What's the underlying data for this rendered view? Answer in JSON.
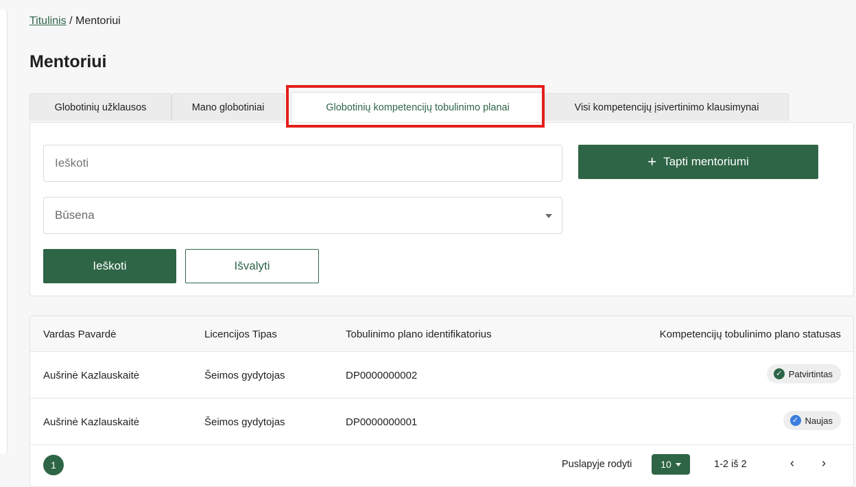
{
  "breadcrumb": {
    "home": "Titulinis",
    "separator": " / ",
    "current": "Mentoriui"
  },
  "page": {
    "title": "Mentoriui"
  },
  "tabs": [
    {
      "label": "Globotinių užklausos"
    },
    {
      "label": "Mano globotiniai"
    },
    {
      "label": "Globotinių kompetencijų tobulinimo planai",
      "active": true
    },
    {
      "label": "Visi kompetencijų įsivertinimo klausimynai"
    }
  ],
  "filters": {
    "search_placeholder": "Ieškoti",
    "status_placeholder": "Būsena",
    "become_mentor_label": "Tapti mentoriumi",
    "search_button": "Ieškoti",
    "clear_button": "Išvalyti"
  },
  "table": {
    "columns": [
      "Vardas Pavardė",
      "Licencijos Tipas",
      "Tobulinimo plano identifikatorius",
      "Kompetencijų tobulinimo plano statusas"
    ],
    "rows": [
      {
        "name": "Aušrinė Kazlauskaitė",
        "license": "Šeimos gydytojas",
        "id": "DP0000000002",
        "status": "Patvirtintas",
        "status_icon": "check-circle-green"
      },
      {
        "name": "Aušrinė Kazlauskaitė",
        "license": "Šeimos gydytojas",
        "id": "DP0000000001",
        "status": "Naujas",
        "status_icon": "check-circle-blue"
      }
    ]
  },
  "pagination": {
    "current_page": "1",
    "per_page_label": "Puslapyje rodyti",
    "per_page_value": "10",
    "range_text": "1-2 iš 2"
  },
  "colors": {
    "primary": "#2e6546",
    "highlight": "#e3201b",
    "info": "#3b7ddd"
  }
}
